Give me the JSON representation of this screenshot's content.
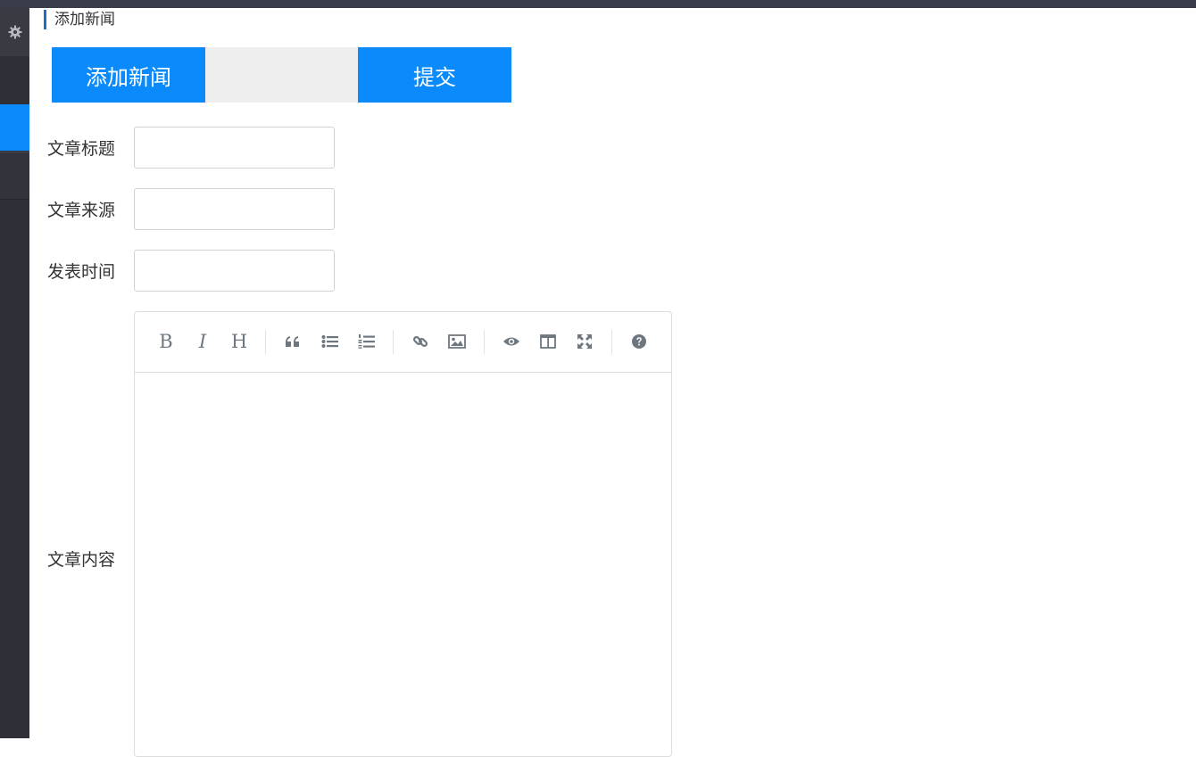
{
  "breadcrumb": "添加新闻",
  "buttons": {
    "add": "添加新闻",
    "submit": "提交"
  },
  "form": {
    "title_label": "文章标题",
    "source_label": "文章来源",
    "time_label": "发表时间",
    "content_label": "文章内容",
    "title_value": "",
    "source_value": "",
    "time_value": ""
  },
  "editor": {
    "toolbar": [
      "bold-icon",
      "italic-icon",
      "heading-icon",
      "quote-icon",
      "unordered-list-icon",
      "ordered-list-icon",
      "link-icon",
      "image-icon",
      "preview-icon",
      "side-by-side-icon",
      "fullscreen-icon",
      "help-icon"
    ],
    "bold": "B",
    "italic": "I",
    "heading": "H"
  },
  "colors": {
    "accent": "#0b8afc",
    "sidebar": "#2f2f37",
    "topbar": "#393d49"
  }
}
